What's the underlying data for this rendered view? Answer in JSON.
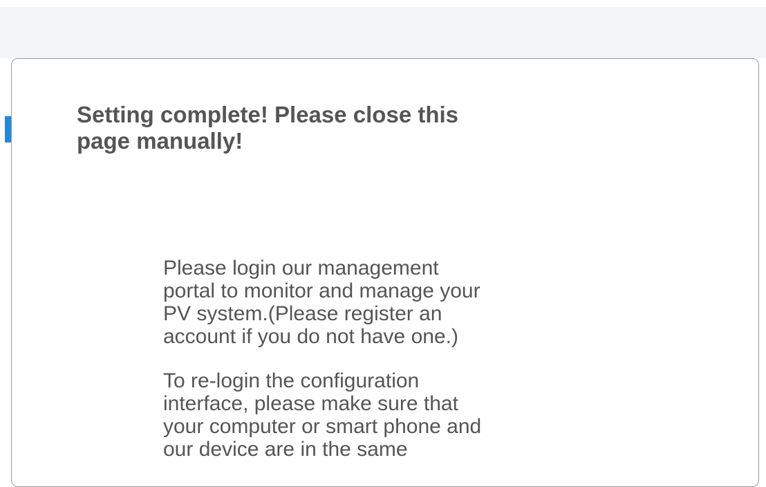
{
  "dialog": {
    "title": "Setting complete! Please close this\npage manually!",
    "paragraphs": [
      "Please login our management\nportal to monitor and manage your\nPV system.(Please register an\naccount if you do not have one.)",
      "To re-login the configuration\ninterface, please make sure that\nyour computer or smart phone and\nour device are in the same"
    ]
  },
  "colors": {
    "accent": "#1e88e5",
    "text": "#555555",
    "header_background": "#f4f5f7"
  }
}
